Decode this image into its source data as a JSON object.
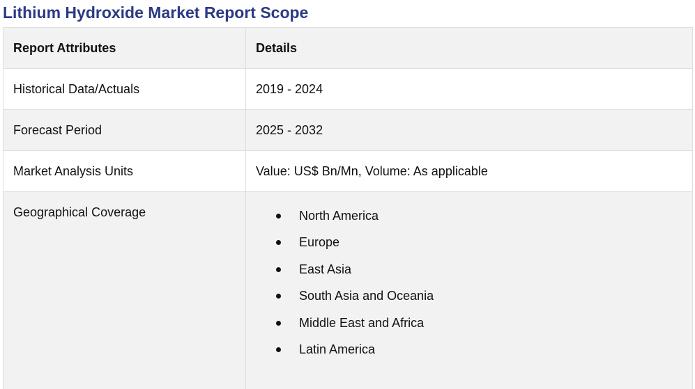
{
  "title": "Lithium Hydroxide Market Report Scope",
  "table": {
    "header": {
      "attribute": "Report Attributes",
      "details": "Details"
    },
    "rows": [
      {
        "attribute": "Historical Data/Actuals",
        "details": "2019 - 2024"
      },
      {
        "attribute": "Forecast Period",
        "details": "2025 - 2032"
      },
      {
        "attribute": "Market Analysis Units",
        "details": "Value: US$ Bn/Mn, Volume: As applicable"
      }
    ],
    "geography": {
      "attribute": "Geographical Coverage",
      "regions": [
        "North America",
        "Europe",
        "East Asia",
        "South Asia and Oceania",
        "Middle East and Africa",
        "Latin America"
      ]
    }
  },
  "colors": {
    "title": "#2b3a86",
    "shaded_row": "#f2f2f2",
    "border": "#dedede"
  }
}
